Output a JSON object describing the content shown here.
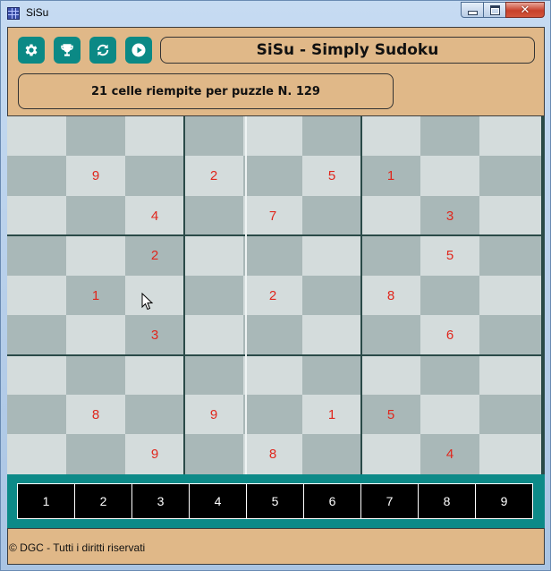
{
  "window": {
    "title": "SiSu",
    "close_glyph": "✕"
  },
  "toolbar": {
    "buttons": [
      {
        "name": "settings",
        "icon": "gear-icon"
      },
      {
        "name": "achievements",
        "icon": "trophy-icon"
      },
      {
        "name": "refresh",
        "icon": "refresh-icon"
      },
      {
        "name": "play",
        "icon": "play-icon"
      }
    ]
  },
  "header": {
    "title": "SiSu - Simply Sudoku",
    "status": "21 celle riempite per puzzle N. 129"
  },
  "board": {
    "colors": {
      "light": "#d4dcdc",
      "dark": "#a9b8b8",
      "digit": "#e0261c"
    },
    "rows": [
      [
        "",
        "",
        "",
        "",
        "",
        "",
        "",
        "",
        ""
      ],
      [
        "",
        "9",
        "",
        "2",
        "",
        "5",
        "1",
        "",
        ""
      ],
      [
        "",
        "",
        "4",
        "",
        "7",
        "",
        "",
        "3",
        ""
      ],
      [
        "",
        "",
        "2",
        "",
        "",
        "",
        "",
        "5",
        ""
      ],
      [
        "",
        "1",
        "",
        "",
        "2",
        "",
        "8",
        "",
        ""
      ],
      [
        "",
        "",
        "3",
        "",
        "",
        "",
        "",
        "6",
        ""
      ],
      [
        "",
        "",
        "",
        "",
        "",
        "",
        "",
        "",
        ""
      ],
      [
        "",
        "8",
        "",
        "9",
        "",
        "1",
        "5",
        "",
        ""
      ],
      [
        "",
        "",
        "9",
        "",
        "8",
        "",
        "",
        "4",
        ""
      ]
    ]
  },
  "numpad": {
    "keys": [
      "1",
      "2",
      "3",
      "4",
      "5",
      "6",
      "7",
      "8",
      "9"
    ]
  },
  "footer": {
    "text": "© DGC - Tutti i diritti riservati"
  }
}
